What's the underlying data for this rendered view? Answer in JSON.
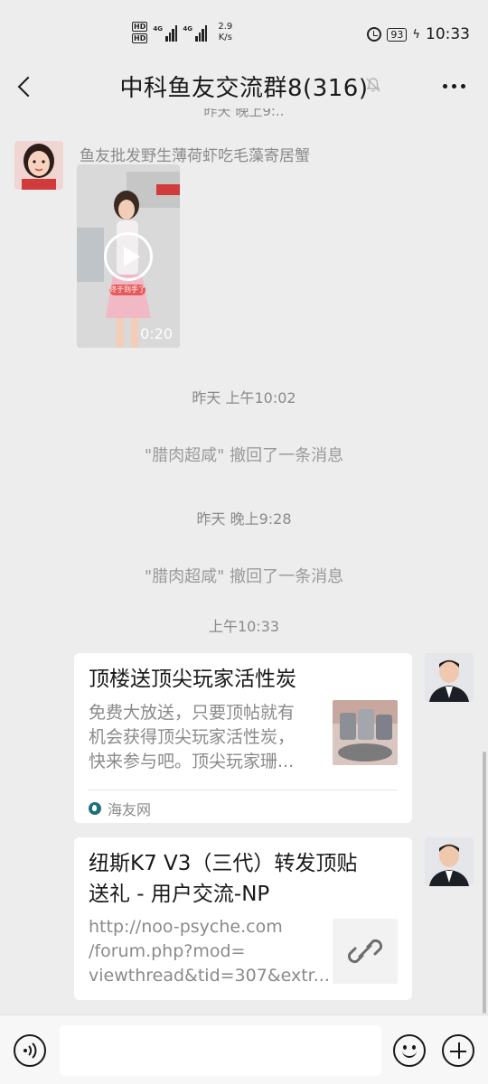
{
  "status_bar": {
    "hd1": "HD",
    "hd2": "HD",
    "network1": "4G",
    "network2": "4G",
    "speed_value": "2.9",
    "speed_unit": "K/s",
    "battery": "93",
    "time": "10:33",
    "icons": [
      "signal-icon",
      "alarm-icon",
      "battery-icon",
      "charging-icon"
    ]
  },
  "header": {
    "title": "中科鱼友交流群8(316)",
    "icons": [
      "back-icon",
      "mute-icon",
      "more-icon"
    ]
  },
  "chat": {
    "partial_time_top": "昨天 晚上9:..",
    "video_message": {
      "sender": "鱼友批发野生薄荷虾吃毛藻寄居蟹",
      "duration": "0:20",
      "overlay_text": "终于到手了"
    },
    "time_1": "昨天 上午10:02",
    "notice_1": "\"腊肉超咸\" 撤回了一条消息",
    "time_2": "昨天 晚上9:28",
    "notice_2": "\"腊肉超咸\" 撤回了一条消息",
    "time_3": "上午10:33",
    "card_1": {
      "title": "顶楼送顶尖玩家活性炭",
      "desc_lines": [
        "免费大放送，只要顶帖就有",
        "机会获得顶尖玩家活性炭，",
        "快来参与吧。顶尖玩家珊..."
      ],
      "source": "海友网"
    },
    "card_2": {
      "title_lines": [
        "纽斯K7 V3（三代）转发顶贴",
        "送礼 - 用户交流-NP"
      ],
      "desc_lines": [
        "http://noo-psyche.com",
        "/forum.php?mod=",
        "viewthread&tid=307&extr..."
      ]
    }
  },
  "input_bar": {
    "placeholder": "",
    "icons": [
      "voice-icon",
      "emoji-icon",
      "plus-icon"
    ]
  },
  "colors": {
    "background": "#ededed",
    "card": "#ffffff",
    "muted_text": "#8a8a8a"
  }
}
